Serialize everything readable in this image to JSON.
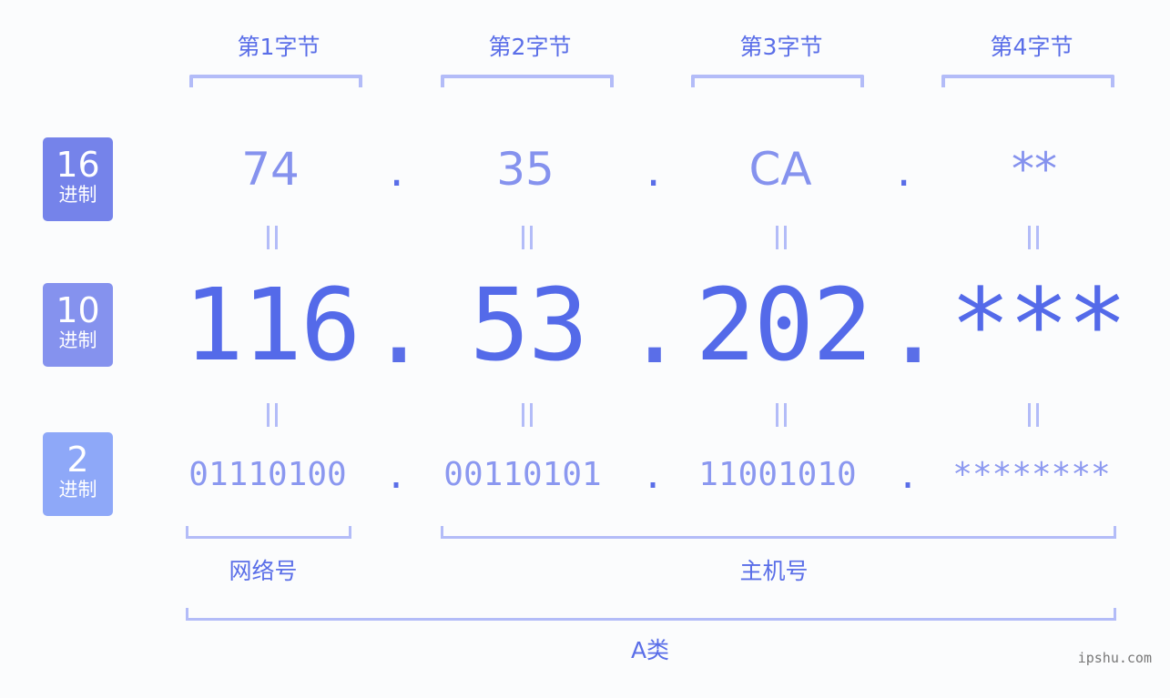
{
  "byte_headers": [
    "第1字节",
    "第2字节",
    "第3字节",
    "第4字节"
  ],
  "rows": {
    "hex": {
      "badge_number": "16",
      "badge_unit": "进制",
      "badge_color": "#7583ea",
      "values": [
        "74",
        "35",
        "CA",
        "**"
      ]
    },
    "decimal": {
      "badge_number": "10",
      "badge_unit": "进制",
      "badge_color": "#8592ee",
      "values": [
        "116",
        "53",
        "202",
        "***"
      ]
    },
    "binary": {
      "badge_number": "2",
      "badge_unit": "进制",
      "badge_color": "#8ea8f8",
      "values": [
        "01110100",
        "00110101",
        "11001010",
        "********"
      ]
    }
  },
  "separator": ".",
  "equals_symbol": "=",
  "network_label": "网络号",
  "host_label": "主机号",
  "class_label": "A类",
  "watermark": "ipshu.com",
  "colors": {
    "accent": "#546ae9",
    "bracket": "#b3bcf8",
    "hex_text": "#8592ee",
    "binary_text": "#8b98f0"
  }
}
